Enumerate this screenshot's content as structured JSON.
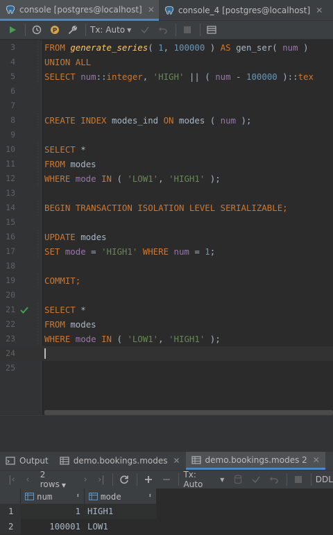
{
  "tabs": [
    {
      "label": "console [postgres@localhost]",
      "active": true
    },
    {
      "label": "console_4 [postgres@localhost]",
      "active": false
    }
  ],
  "toolbar": {
    "tx_mode": "Tx: Auto"
  },
  "editor": {
    "lines": [
      {
        "n": "3",
        "tokens": [
          [
            "kw",
            "FROM "
          ],
          [
            "fn",
            "generate_series"
          ],
          [
            "plain",
            "( "
          ],
          [
            "num",
            "1"
          ],
          [
            "plain",
            ", "
          ],
          [
            "num",
            "100000"
          ],
          [
            "plain",
            " ) "
          ],
          [
            "kw",
            "AS "
          ],
          [
            "plain",
            "gen_ser( "
          ],
          [
            "col",
            "num"
          ],
          [
            "plain",
            " )"
          ]
        ]
      },
      {
        "n": "4",
        "tokens": [
          [
            "kw",
            "UNION ALL"
          ]
        ]
      },
      {
        "n": "5",
        "tokens": [
          [
            "kw",
            "SELECT "
          ],
          [
            "col",
            "num"
          ],
          [
            "plain",
            "::"
          ],
          [
            "kw",
            "integer"
          ],
          [
            "plain",
            ", "
          ],
          [
            "str",
            "'HIGH'"
          ],
          [
            "plain",
            " || ( "
          ],
          [
            "col",
            "num"
          ],
          [
            "plain",
            " - "
          ],
          [
            "num",
            "100000"
          ],
          [
            "plain",
            " )::"
          ],
          [
            "kw",
            "tex"
          ]
        ]
      },
      {
        "n": "6",
        "tokens": []
      },
      {
        "n": "7",
        "tokens": []
      },
      {
        "n": "8",
        "tokens": [
          [
            "kw",
            "CREATE INDEX "
          ],
          [
            "plain",
            "modes_ind "
          ],
          [
            "kw",
            "ON "
          ],
          [
            "plain",
            "modes ( "
          ],
          [
            "col",
            "num"
          ],
          [
            "plain",
            " );"
          ]
        ]
      },
      {
        "n": "9",
        "tokens": []
      },
      {
        "n": "10",
        "tokens": [
          [
            "kw",
            "SELECT "
          ],
          [
            "plain",
            "*"
          ]
        ]
      },
      {
        "n": "11",
        "tokens": [
          [
            "kw",
            "FROM "
          ],
          [
            "plain",
            "modes"
          ]
        ]
      },
      {
        "n": "12",
        "tokens": [
          [
            "kw",
            "WHERE "
          ],
          [
            "col",
            "mode"
          ],
          [
            "kw",
            " IN "
          ],
          [
            "plain",
            "( "
          ],
          [
            "str",
            "'LOW1'"
          ],
          [
            "plain",
            ", "
          ],
          [
            "str",
            "'HIGH1'"
          ],
          [
            "plain",
            " );"
          ]
        ]
      },
      {
        "n": "13",
        "tokens": []
      },
      {
        "n": "14",
        "tokens": [
          [
            "kw",
            "BEGIN TRANSACTION ISOLATION LEVEL SERIALIZABLE;"
          ]
        ]
      },
      {
        "n": "15",
        "tokens": []
      },
      {
        "n": "16",
        "tokens": [
          [
            "kw",
            "UPDATE "
          ],
          [
            "plain",
            "modes"
          ]
        ]
      },
      {
        "n": "17",
        "tokens": [
          [
            "kw",
            "SET "
          ],
          [
            "col",
            "mode"
          ],
          [
            "plain",
            " = "
          ],
          [
            "str",
            "'HIGH1'"
          ],
          [
            "kw",
            " WHERE "
          ],
          [
            "col",
            "num"
          ],
          [
            "plain",
            " = "
          ],
          [
            "num",
            "1"
          ],
          [
            "plain",
            ";"
          ]
        ]
      },
      {
        "n": "18",
        "tokens": []
      },
      {
        "n": "19",
        "tokens": [
          [
            "kw",
            "COMMIT;"
          ]
        ]
      },
      {
        "n": "20",
        "tokens": []
      },
      {
        "n": "21",
        "tokens": [
          [
            "kw",
            "SELECT "
          ],
          [
            "plain",
            "*"
          ]
        ],
        "executed": true
      },
      {
        "n": "22",
        "tokens": [
          [
            "kw",
            "FROM "
          ],
          [
            "plain",
            "modes"
          ]
        ]
      },
      {
        "n": "23",
        "tokens": [
          [
            "kw",
            "WHERE "
          ],
          [
            "col",
            "mode"
          ],
          [
            "kw",
            " IN "
          ],
          [
            "plain",
            "( "
          ],
          [
            "str",
            "'LOW1'"
          ],
          [
            "plain",
            ", "
          ],
          [
            "str",
            "'HIGH1'"
          ],
          [
            "plain",
            " );"
          ]
        ]
      },
      {
        "n": "24",
        "tokens": [],
        "current": true
      },
      {
        "n": "25",
        "tokens": []
      }
    ]
  },
  "results": {
    "tabs": [
      {
        "label": "Output",
        "icon": "output-icon"
      },
      {
        "label": "demo.bookings.modes",
        "icon": "table-icon"
      },
      {
        "label": "demo.bookings.modes 2",
        "icon": "table-icon",
        "active": true
      }
    ],
    "toolbar": {
      "rows": "2 rows",
      "tx_mode": "Tx: Auto",
      "ddl": "DDL"
    },
    "columns": [
      {
        "name": "num"
      },
      {
        "name": "mode"
      }
    ],
    "rows": [
      {
        "rn": "1",
        "num": "1",
        "mode": "HIGH1"
      },
      {
        "rn": "2",
        "num": "100001",
        "mode": "LOW1"
      }
    ]
  },
  "colors": {
    "keyword": "#cc7832",
    "function": "#ffc66d",
    "number": "#6897bb",
    "string": "#6a8759",
    "column": "#9876aa",
    "accent": "#4a88c7",
    "ok": "#499c54"
  }
}
